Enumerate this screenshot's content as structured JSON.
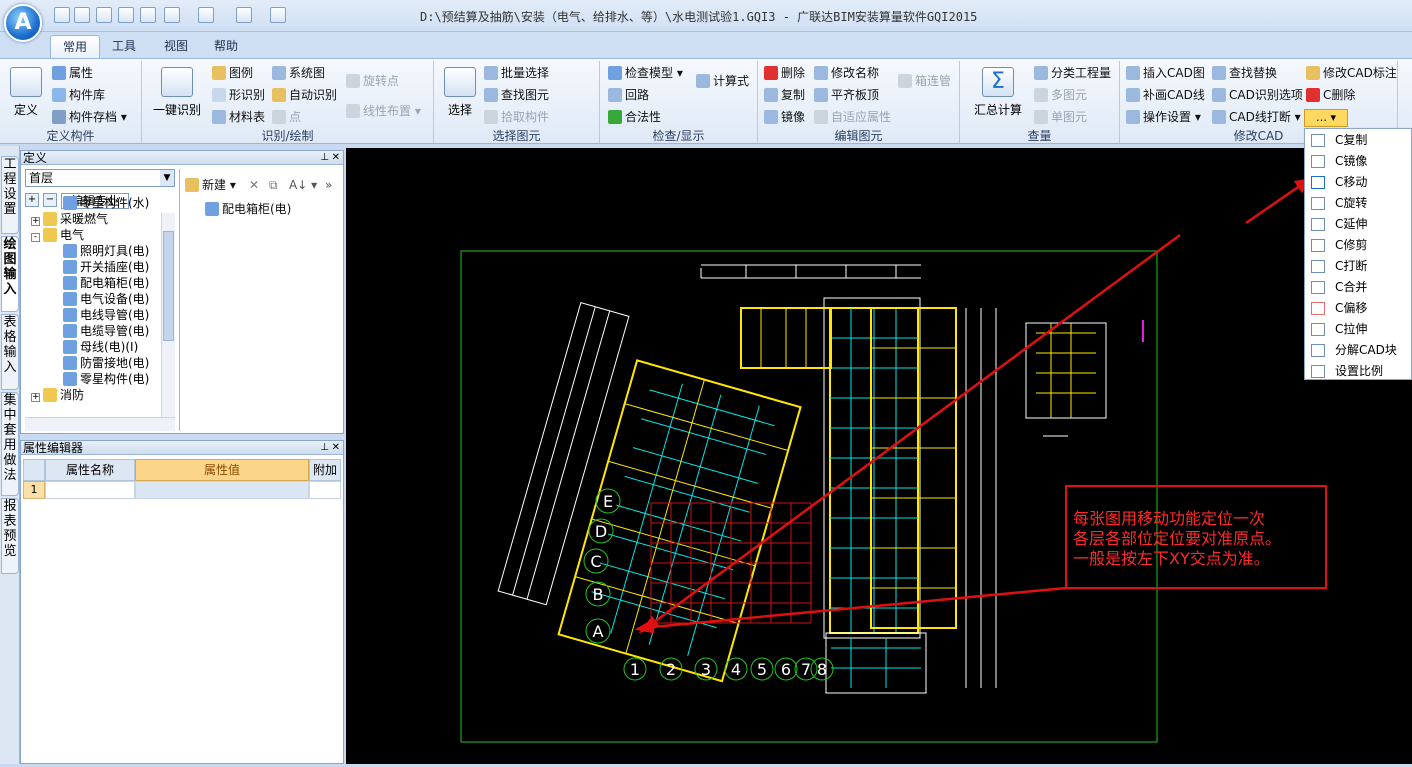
{
  "app": {
    "title": "D:\\预结算及抽筋\\安装（电气、给排水、等）\\水电测试验1.GQI3 - 广联达BIM安装算量软件GQI2015",
    "orb": "A"
  },
  "tabs": [
    "常用",
    "工具",
    "视图",
    "帮助"
  ],
  "ribbon": {
    "g1": {
      "label": "定义构件",
      "big": "定义",
      "items": [
        "属性",
        "构件库",
        "构件存档"
      ]
    },
    "g2": {
      "label": "识别/绘制",
      "big": "一键识别",
      "items": [
        "图例",
        "形识别",
        "材料表",
        "系统图",
        "自动识别",
        "点",
        "旋转点",
        "线性布置"
      ]
    },
    "g3": {
      "label": "选择图元",
      "big": "选择",
      "items": [
        "批量选择",
        "查找图元",
        "拾取构件"
      ]
    },
    "g4": {
      "label": "检查/显示",
      "items": [
        "检查模型",
        "回路",
        "合法性",
        "计算式"
      ]
    },
    "g5": {
      "label": "编辑图元",
      "items": [
        "删除",
        "复制",
        "镜像",
        "修改名称",
        "平齐板顶",
        "自适应属性",
        "箱连管"
      ]
    },
    "g6": {
      "label": "查量",
      "big": "汇总计算",
      "items": [
        "分类工程量",
        "多图元",
        "单图元"
      ]
    },
    "g7": {
      "label": "修改CAD",
      "items": [
        "插入CAD图",
        "补画CAD线",
        "操作设置",
        "查找替换",
        "CAD识别选项",
        "CAD线打断",
        "修改CAD标注",
        "C删除"
      ]
    }
  },
  "side_tabs": [
    "工程设置",
    "绘图输入",
    "表格输入",
    "集中套用做法",
    "报表预览"
  ],
  "def_panel": {
    "title": "定义",
    "floor": "首层",
    "tab_label": "编辑专业",
    "new_btn": "新建",
    "tree": [
      {
        "label": "零星构件(水)",
        "indent": 2
      },
      {
        "label": "采暖燃气",
        "indent": 1,
        "folder": true,
        "exp": "+"
      },
      {
        "label": "电气",
        "indent": 1,
        "folder": true,
        "exp": "-"
      },
      {
        "label": "照明灯具(电)",
        "indent": 2
      },
      {
        "label": "开关插座(电)",
        "indent": 2
      },
      {
        "label": "配电箱柜(电)",
        "indent": 2
      },
      {
        "label": "电气设备(电)",
        "indent": 2
      },
      {
        "label": "电线导管(电)",
        "indent": 2
      },
      {
        "label": "电缆导管(电)",
        "indent": 2
      },
      {
        "label": "母线(电)(I)",
        "indent": 2
      },
      {
        "label": "防雷接地(电)",
        "indent": 2
      },
      {
        "label": "零星构件(电)",
        "indent": 2
      },
      {
        "label": "消防",
        "indent": 1,
        "folder": true,
        "exp": "+"
      }
    ],
    "list_item": "配电箱柜(电)"
  },
  "props_panel": {
    "title": "属性编辑器",
    "columns": [
      "属性名称",
      "属性值",
      "附加"
    ],
    "row_num": "1"
  },
  "context_menu": [
    "C复制",
    "C镜像",
    "C移动",
    "C旋转",
    "C延伸",
    "C修剪",
    "C打断",
    "C合并",
    "C偏移",
    "C拉伸",
    "分解CAD块",
    "设置比例"
  ],
  "annotation": [
    "每张图用移动功能定位一次",
    "各层各部位定位要对准原点。",
    "一般是按左下XY交点为准。"
  ],
  "grid_labels": {
    "rows": [
      "E",
      "D",
      "C",
      "B",
      "A"
    ],
    "cols": [
      "1",
      "2",
      "3",
      "4",
      "5",
      "6",
      "7",
      "8"
    ]
  },
  "colors": {
    "annot_red": "#e01010",
    "cad_green": "#22c422",
    "cad_yellow": "#ffe800",
    "cad_cyan": "#00e8e8"
  }
}
